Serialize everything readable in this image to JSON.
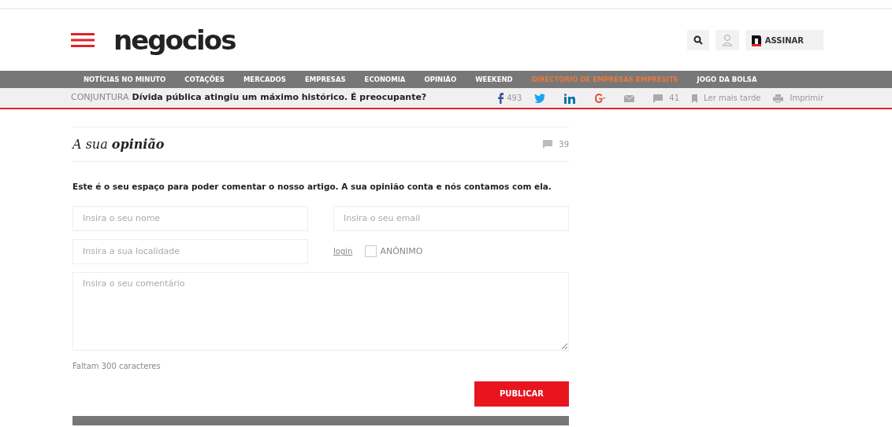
{
  "header": {
    "logo": "negocios",
    "subscribe": "ASSINAR"
  },
  "nav": [
    {
      "label": "NOTÍCIAS NO MINUTO",
      "highlighted": false
    },
    {
      "label": "COTAÇÕES",
      "highlighted": false
    },
    {
      "label": "MERCADOS",
      "highlighted": false
    },
    {
      "label": "EMPRESAS",
      "highlighted": false
    },
    {
      "label": "ECONOMIA",
      "highlighted": false
    },
    {
      "label": "OPINIÃO",
      "highlighted": false
    },
    {
      "label": "WEEKEND",
      "highlighted": false
    },
    {
      "label": "DIRECTÓRIO DE EMPRESAS EMPRESITE",
      "highlighted": true
    },
    {
      "label": "JOGO DA BOLSA",
      "highlighted": false
    }
  ],
  "article_bar": {
    "section": "CONJUNTURA",
    "headline": "Dívida pública atingiu um máximo histórico. É preocupante?",
    "facebook_count": "493",
    "comments_count": "41",
    "read_later": "Ler mais tarde",
    "print": "Imprimir"
  },
  "comments": {
    "title_light": "A sua",
    "title_bold": "opinião",
    "count": "39",
    "intro": "Este é o seu espaço para poder comentar o nosso artigo. A sua opinião conta e nós contamos com ela.",
    "name_placeholder": "Insira o seu nome",
    "email_placeholder": "Insira o seu email",
    "location_placeholder": "Insira a sua localidade",
    "login": "login",
    "anonymous": {
      "label": "ANÓNIMO",
      "checked": false
    },
    "comment_placeholder": "Insira o seu comentário",
    "remaining": "Faltam 300 caracteres",
    "publish": "PUBLICAR"
  }
}
